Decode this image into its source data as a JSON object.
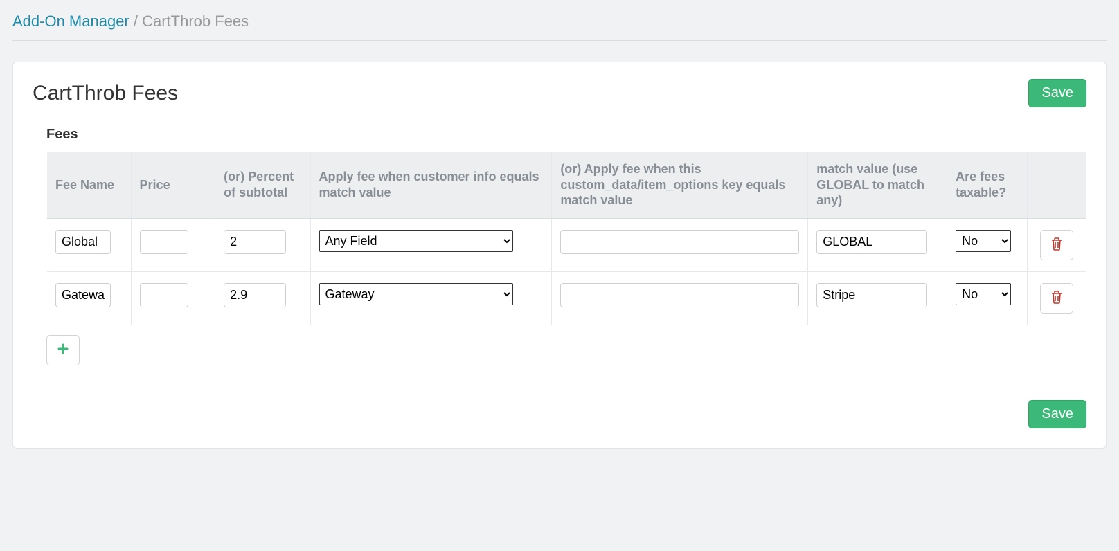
{
  "breadcrumb": {
    "parent": "Add-On Manager",
    "separator": " / ",
    "current": "CartThrob Fees"
  },
  "panel": {
    "title": "CartThrob Fees",
    "save_label": "Save",
    "section_label": "Fees"
  },
  "table": {
    "headers": {
      "name": "Fee Name",
      "price": "Price",
      "percent": "(or) Percent of subtotal",
      "apply": "Apply fee when customer info equals match value",
      "key": "(or) Apply fee when this custom_data/item_options key equals match value",
      "match": "match value (use GLOBAL to match any)",
      "tax": "Are fees taxable?"
    },
    "rows": [
      {
        "name": "Global",
        "price": "",
        "percent": "2",
        "apply": "Any Field",
        "key": "",
        "match": "GLOBAL",
        "tax": "No"
      },
      {
        "name": "Gateway",
        "price": "",
        "percent": "2.9",
        "apply": "Gateway",
        "key": "",
        "match": "Stripe",
        "tax": "No"
      }
    ]
  },
  "icons": {
    "trash": "trash",
    "plus": "plus"
  }
}
